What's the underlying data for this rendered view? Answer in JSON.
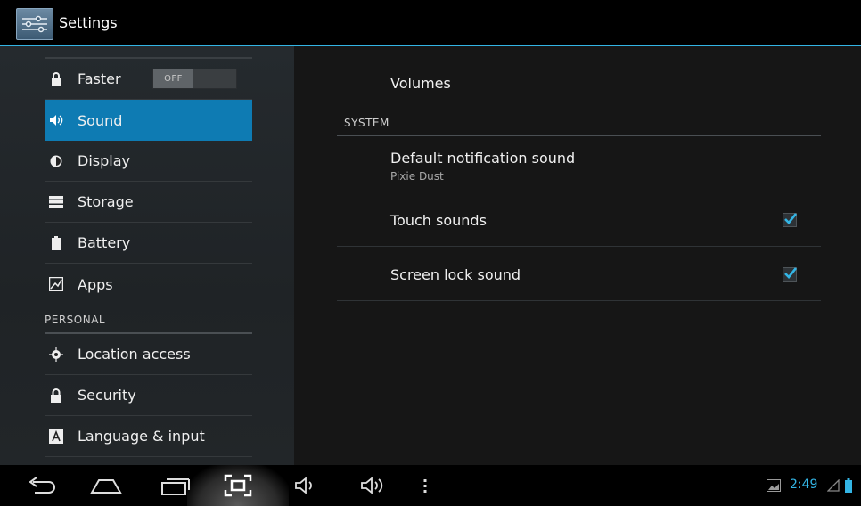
{
  "action_bar": {
    "title": "Settings",
    "app_icon": "settings-sliders-icon"
  },
  "sidebar": {
    "items": [
      {
        "label": "Faster",
        "icon": "lock-icon",
        "toggle": "OFF"
      },
      {
        "label": "Sound",
        "icon": "speaker-icon",
        "selected": true
      },
      {
        "label": "Display",
        "icon": "brightness-icon"
      },
      {
        "label": "Storage",
        "icon": "storage-icon"
      },
      {
        "label": "Battery",
        "icon": "battery-icon"
      },
      {
        "label": "Apps",
        "icon": "apps-icon"
      },
      {
        "label": "Location access",
        "icon": "location-icon"
      },
      {
        "label": "Security",
        "icon": "lock-icon"
      },
      {
        "label": "Language & input",
        "icon": "language-icon"
      }
    ],
    "personal_header": "PERSONAL"
  },
  "main": {
    "volumes": "Volumes",
    "system_header": "SYSTEM",
    "notification": {
      "title": "Default notification sound",
      "summary": "Pixie Dust"
    },
    "touch_sounds": {
      "title": "Touch sounds",
      "checked": true
    },
    "screen_lock_sound": {
      "title": "Screen lock sound",
      "checked": true
    }
  },
  "navbar": {
    "clock": "2:49"
  },
  "colors": {
    "accent": "#33b5e5",
    "selected": "#0e7bb3"
  }
}
